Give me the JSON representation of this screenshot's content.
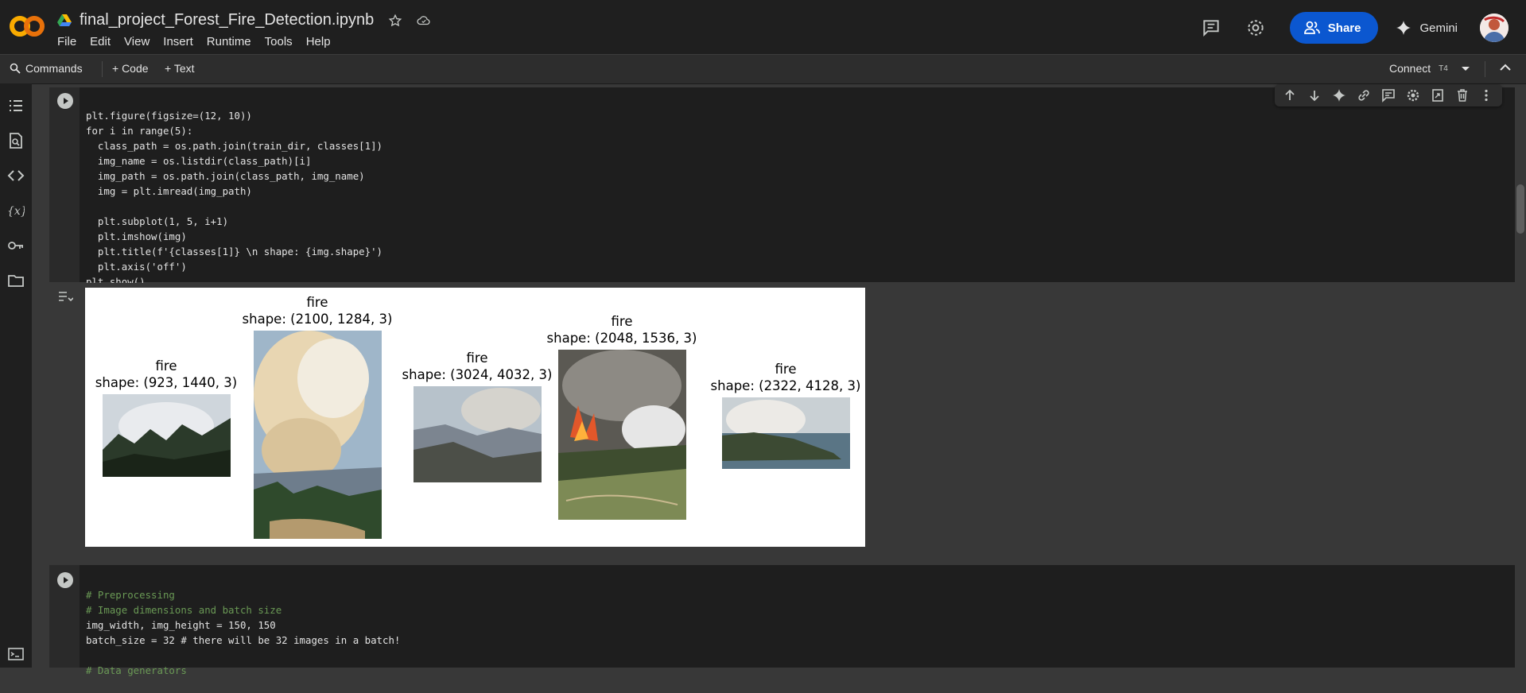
{
  "header": {
    "notebook_title": "final_project_Forest_Fire_Detection.ipynb",
    "menu": [
      "File",
      "Edit",
      "View",
      "Insert",
      "Runtime",
      "Tools",
      "Help"
    ],
    "share_label": "Share",
    "gemini_label": "Gemini"
  },
  "toolbar": {
    "commands_label": "Commands",
    "code_label": "+ Code",
    "text_label": "+ Text",
    "connect_label": "Connect",
    "runtime_badge": "T4"
  },
  "cell1": {
    "lines": [
      "plt.figure(figsize=(12, 10))",
      "for i in range(5):",
      "  class_path = os.path.join(train_dir, classes[1])",
      "  img_name = os.listdir(class_path)[i]",
      "  img_path = os.path.join(class_path, img_name)",
      "  img = plt.imread(img_path)",
      "",
      "  plt.subplot(1, 5, i+1)",
      "  plt.imshow(img)",
      "  plt.title(f'{classes[1]} \\n shape: {img.shape}')",
      "  plt.axis('off')",
      "plt.show()"
    ]
  },
  "output": {
    "subplots": [
      {
        "class": "fire",
        "shape": "shape: (923, 1440, 3)"
      },
      {
        "class": "fire",
        "shape": "shape: (2100, 1284, 3)"
      },
      {
        "class": "fire",
        "shape": "shape: (3024, 4032, 3)"
      },
      {
        "class": "fire",
        "shape": "shape: (2048, 1536, 3)"
      },
      {
        "class": "fire",
        "shape": "shape: (2322, 4128, 3)"
      }
    ]
  },
  "cell2": {
    "lines": [
      "# Preprocessing",
      "# Image dimensions and batch size",
      "img_width, img_height = 150, 150",
      "batch_size = 32 # there will be 32 images in a batch!",
      "",
      "# Data generators"
    ]
  },
  "colors": {
    "share_bg": "#0b57d0",
    "cell_bg": "#1e1e1e",
    "page_bg": "#383838"
  }
}
